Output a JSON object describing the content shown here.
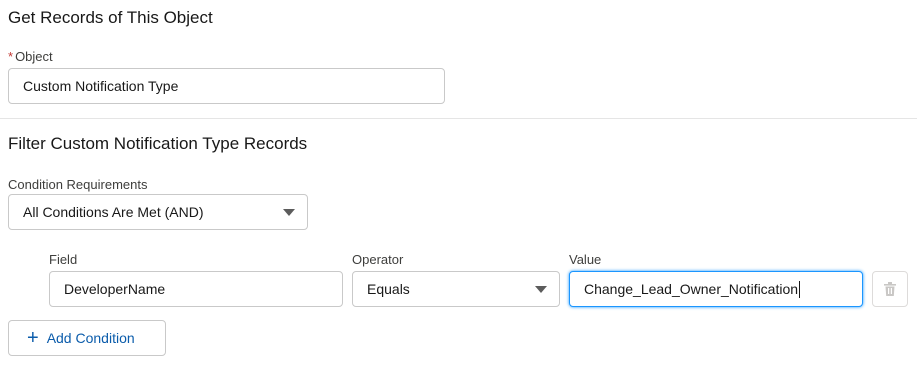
{
  "get_records": {
    "title": "Get Records of This Object",
    "object_label": "Object",
    "required_marker": "*",
    "object_value": "Custom Notification Type"
  },
  "filter": {
    "title": "Filter Custom Notification Type Records",
    "condition_label": "Condition Requirements",
    "condition_value": "All Conditions Are Met (AND)",
    "field_label": "Field",
    "field_value": "DeveloperName",
    "operator_label": "Operator",
    "operator_value": "Equals",
    "value_label": "Value",
    "value_value": "Change_Lead_Owner_Notification",
    "add_condition_label": "Add Condition"
  },
  "icons": {
    "delete": "trash-icon",
    "add": "plus-icon",
    "dropdown": "chevron-down-icon"
  }
}
